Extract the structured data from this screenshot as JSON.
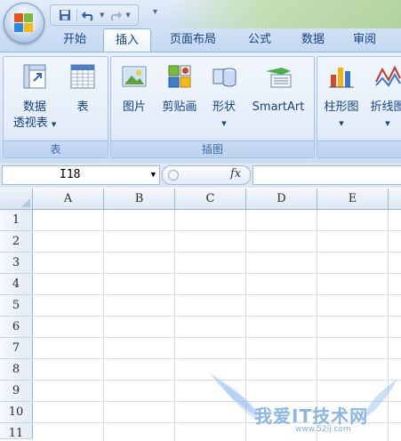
{
  "quick_access": {
    "buttons": [
      "save-icon",
      "undo-icon",
      "redo-icon"
    ]
  },
  "tabs": [
    {
      "label": "开始",
      "active": false
    },
    {
      "label": "插入",
      "active": true
    },
    {
      "label": "页面布局",
      "active": false
    },
    {
      "label": "公式",
      "active": false
    },
    {
      "label": "数据",
      "active": false
    },
    {
      "label": "审阅",
      "active": false
    }
  ],
  "ribbon": {
    "groups": [
      {
        "label": "表",
        "buttons": [
          {
            "label_line1": "数据",
            "label_line2": "透视表",
            "icon": "pivot-table-icon",
            "has_dropdown": true
          },
          {
            "label_line1": "表",
            "label_line2": "",
            "icon": "table-icon",
            "has_dropdown": false
          }
        ]
      },
      {
        "label": "插图",
        "buttons": [
          {
            "label_line1": "图片",
            "icon": "picture-icon"
          },
          {
            "label_line1": "剪贴画",
            "icon": "clipart-icon"
          },
          {
            "label_line1": "形状",
            "icon": "shapes-icon",
            "has_dropdown": true
          },
          {
            "label_line1": "SmartArt",
            "icon": "smartart-icon"
          }
        ]
      },
      {
        "label": "",
        "buttons": [
          {
            "label_line1": "柱形图",
            "icon": "column-chart-icon",
            "has_dropdown": true
          },
          {
            "label_line1": "折线图",
            "icon": "line-chart-icon",
            "has_dropdown": true
          }
        ]
      }
    ]
  },
  "formula_bar": {
    "name_box": "I18",
    "fx_label": "fx",
    "formula_value": ""
  },
  "sheet": {
    "columns": [
      "A",
      "B",
      "C",
      "D",
      "E"
    ],
    "rows": [
      "1",
      "2",
      "3",
      "4",
      "5",
      "6",
      "7",
      "8",
      "9",
      "10",
      "11"
    ]
  },
  "watermark": {
    "text": "我爱IT技术网",
    "sub": "www.52ij.com"
  },
  "colors": {
    "ribbon_text": "#15428b",
    "accent": "#8db2e3",
    "watermark": "#78aae1"
  }
}
